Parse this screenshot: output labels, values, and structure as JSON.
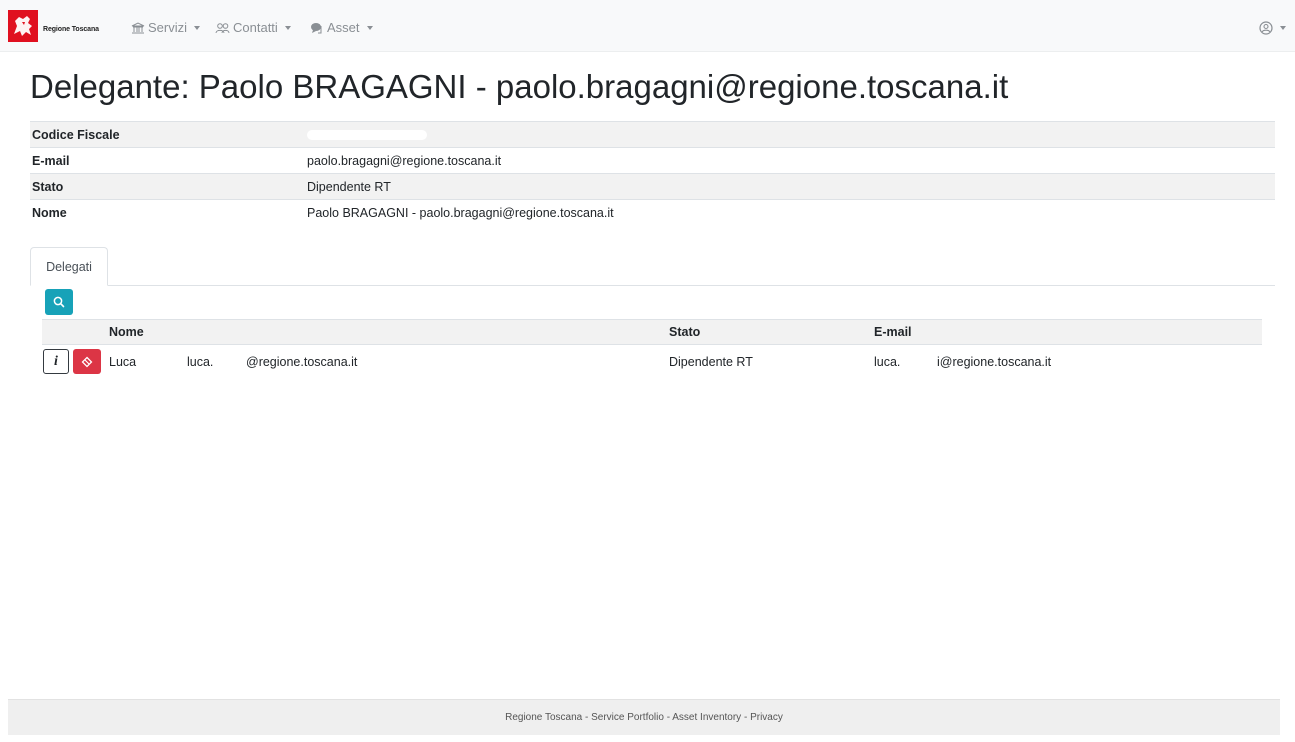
{
  "navbar": {
    "brand": "Regione Toscana",
    "menus": [
      {
        "label": "Servizi",
        "icon": "building-icon"
      },
      {
        "label": "Contatti",
        "icon": "people-icon"
      },
      {
        "label": "Asset",
        "icon": "chat-icon"
      }
    ],
    "user_icon": "user-circle-icon"
  },
  "page": {
    "title": "Delegante: Paolo BRAGAGNI - paolo.bragagni@regione.toscana.it"
  },
  "details": [
    {
      "key": "Codice Fiscale",
      "value": ""
    },
    {
      "key": "E-mail",
      "value": "paolo.bragagni@regione.toscana.it"
    },
    {
      "key": "Stato",
      "value": "Dipendente RT"
    },
    {
      "key": "Nome",
      "value": "Paolo BRAGAGNI - paolo.bragagni@regione.toscana.it"
    }
  ],
  "tabs": [
    {
      "label": "Delegati",
      "active": true
    }
  ],
  "delegati": {
    "columns": [
      "Nome",
      "Stato",
      "E-mail"
    ],
    "rows": [
      {
        "info_label": "i",
        "nome": "Luca",
        "nome_email_part1": "luca.",
        "nome_email_part2": "@regione.toscana.it",
        "stato": "Dipendente RT",
        "email_part1": "luca.",
        "email_part2": "i@regione.toscana.it"
      }
    ]
  },
  "footer": {
    "links": [
      "Regione Toscana",
      "Service Portfolio",
      "Asset Inventory",
      "Privacy"
    ],
    "separator": " - "
  },
  "colors": {
    "brand_red": "#e0101f",
    "info_button": "#17a2b8",
    "danger_button": "#dc3545"
  }
}
